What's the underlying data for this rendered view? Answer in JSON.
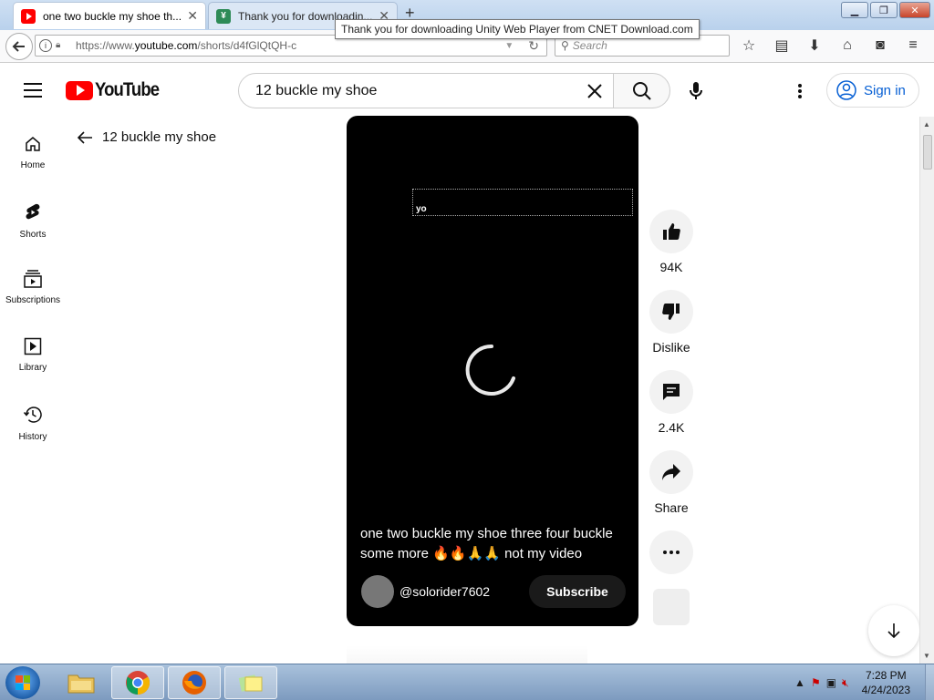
{
  "browser": {
    "tabs": [
      {
        "label": "one two buckle my shoe th...",
        "active": true
      },
      {
        "label": "Thank you for downloadin...",
        "active": false
      }
    ],
    "tooltip": "Thank you for downloading Unity Web Player from CNET Download.com",
    "url_prefix": "https://www.",
    "url_domain": "youtube.com",
    "url_path": "/shorts/d4fGlQtQH-c",
    "search_placeholder": "Search"
  },
  "youtube": {
    "logo_text": "YouTube",
    "search_query": "12 buckle my shoe",
    "sign_in_label": "Sign in",
    "sidebar": [
      {
        "label": "Home",
        "icon": "home-icon"
      },
      {
        "label": "Shorts",
        "icon": "shorts-icon"
      },
      {
        "label": "Subscriptions",
        "icon": "subscriptions-icon"
      },
      {
        "label": "Library",
        "icon": "library-icon"
      },
      {
        "label": "History",
        "icon": "history-icon"
      }
    ],
    "back_label": "12 buckle my shoe",
    "player": {
      "caption_text": "yo",
      "video_title": "one two buckle my shoe three four buckle some more 🔥🔥🙏🙏 not my video",
      "channel_name": "@solorider7602",
      "subscribe_label": "Subscribe"
    },
    "actions": {
      "likes": "94K",
      "dislike_label": "Dislike",
      "comments": "2.4K",
      "share_label": "Share"
    }
  },
  "taskbar": {
    "time": "7:28 PM",
    "date": "4/24/2023"
  }
}
